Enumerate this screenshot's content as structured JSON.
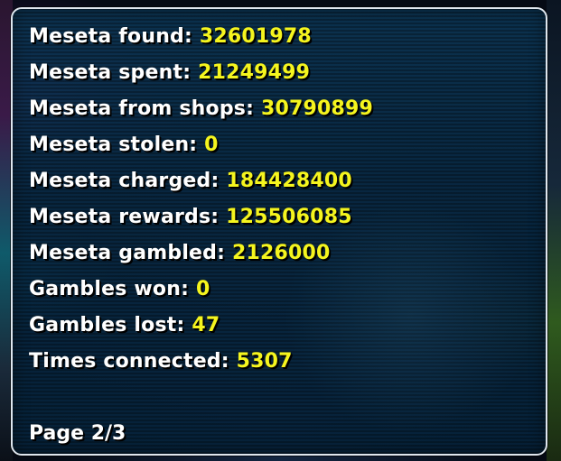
{
  "stats": [
    {
      "label": "Meseta found: ",
      "value": "32601978"
    },
    {
      "label": "Meseta spent: ",
      "value": "21249499"
    },
    {
      "label": "Meseta from shops: ",
      "value": "30790899"
    },
    {
      "label": "Meseta stolen: ",
      "value": "0"
    },
    {
      "label": "Meseta charged: ",
      "value": "184428400"
    },
    {
      "label": "Meseta rewards: ",
      "value": "125506085"
    },
    {
      "label": "Meseta gambled: ",
      "value": "2126000"
    },
    {
      "label": "Gambles won: ",
      "value": "0"
    },
    {
      "label": "Gambles lost: ",
      "value": "47"
    },
    {
      "label": "Times connected: ",
      "value": "5307"
    }
  ],
  "page": {
    "label": "Page 2/3"
  },
  "colors": {
    "label_text": "#ffffff",
    "value_text": "#f5f51e",
    "panel_border": "#dfe6ee",
    "panel_fill": "#0c3452"
  }
}
